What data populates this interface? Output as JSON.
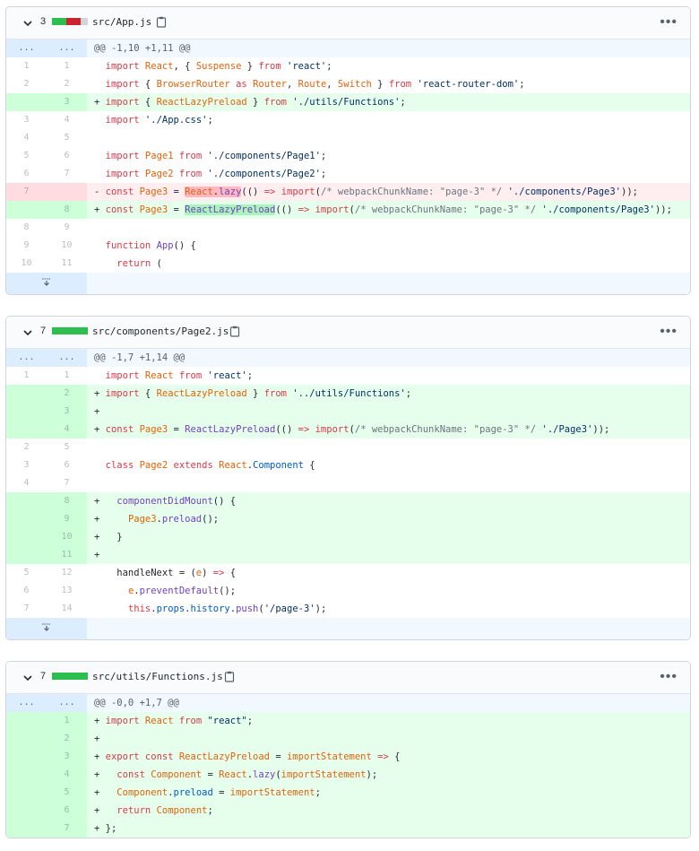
{
  "files": [
    {
      "count": "3",
      "name": "src/App.js",
      "stat": [
        "add",
        "add",
        "del",
        "del",
        "neutral"
      ],
      "menu": "•••",
      "expand_bottom": true,
      "lines": [
        {
          "type": "hunk",
          "n1": "...",
          "n2": "...",
          "text": "@@ -1,10 +1,11 @@"
        },
        {
          "type": "ctx",
          "n1": "1",
          "n2": "1",
          "text": "  import React, { Suspense } from 'react';"
        },
        {
          "type": "ctx",
          "n1": "2",
          "n2": "2",
          "text": "  import { BrowserRouter as Router, Route, Switch } from 'react-router-dom';"
        },
        {
          "type": "add",
          "n1": "",
          "n2": "3",
          "text": "+ import { ReactLazyPreload } from './utils/Functions';"
        },
        {
          "type": "ctx",
          "n1": "3",
          "n2": "4",
          "text": "  import './App.css';"
        },
        {
          "type": "ctx",
          "n1": "4",
          "n2": "5",
          "text": ""
        },
        {
          "type": "ctx",
          "n1": "5",
          "n2": "6",
          "text": "  import Page1 from './components/Page1';"
        },
        {
          "type": "ctx",
          "n1": "6",
          "n2": "7",
          "text": "  import Page2 from './components/Page2';"
        },
        {
          "type": "del",
          "n1": "7",
          "n2": "",
          "text": "- const Page3 = React.lazy(() => import(/* webpackChunkName: \"page-3\" */ './components/Page3'));"
        },
        {
          "type": "add",
          "n1": "",
          "n2": "8",
          "text": "+ const Page3 = ReactLazyPreload(() => import(/* webpackChunkName: \"page-3\" */ './components/Page3'));"
        },
        {
          "type": "ctx",
          "n1": "8",
          "n2": "9",
          "text": ""
        },
        {
          "type": "ctx",
          "n1": "9",
          "n2": "10",
          "text": "  function App() {"
        },
        {
          "type": "ctx",
          "n1": "10",
          "n2": "11",
          "text": "    return ("
        }
      ]
    },
    {
      "count": "7",
      "name": "src/components/Page2.js",
      "stat": [
        "add",
        "add",
        "add",
        "add",
        "add"
      ],
      "menu": "•••",
      "expand_bottom": true,
      "lines": [
        {
          "type": "hunk",
          "n1": "...",
          "n2": "...",
          "text": "@@ -1,7 +1,14 @@"
        },
        {
          "type": "ctx",
          "n1": "1",
          "n2": "1",
          "text": "  import React from 'react';"
        },
        {
          "type": "add",
          "n1": "",
          "n2": "2",
          "text": "+ import { ReactLazyPreload } from '../utils/Functions';"
        },
        {
          "type": "add",
          "n1": "",
          "n2": "3",
          "text": "+"
        },
        {
          "type": "add",
          "n1": "",
          "n2": "4",
          "text": "+ const Page3 = ReactLazyPreload(() => import(/* webpackChunkName: \"page-3\" */ './Page3'));"
        },
        {
          "type": "ctx",
          "n1": "2",
          "n2": "5",
          "text": ""
        },
        {
          "type": "ctx",
          "n1": "3",
          "n2": "6",
          "text": "  class Page2 extends React.Component {"
        },
        {
          "type": "ctx",
          "n1": "4",
          "n2": "7",
          "text": ""
        },
        {
          "type": "add",
          "n1": "",
          "n2": "8",
          "text": "+   componentDidMount() {"
        },
        {
          "type": "add",
          "n1": "",
          "n2": "9",
          "text": "+     Page3.preload();"
        },
        {
          "type": "add",
          "n1": "",
          "n2": "10",
          "text": "+   }"
        },
        {
          "type": "add",
          "n1": "",
          "n2": "11",
          "text": "+"
        },
        {
          "type": "ctx",
          "n1": "5",
          "n2": "12",
          "text": "    handleNext = (e) => {"
        },
        {
          "type": "ctx",
          "n1": "6",
          "n2": "13",
          "text": "      e.preventDefault();"
        },
        {
          "type": "ctx",
          "n1": "7",
          "n2": "14",
          "text": "      this.props.history.push('/page-3');"
        }
      ]
    },
    {
      "count": "7",
      "name": "src/utils/Functions.js",
      "stat": [
        "add",
        "add",
        "add",
        "add",
        "add"
      ],
      "menu": "•••",
      "expand_bottom": false,
      "lines": [
        {
          "type": "hunk",
          "n1": "...",
          "n2": "...",
          "text": "@@ -0,0 +1,7 @@"
        },
        {
          "type": "add",
          "n1": "",
          "n2": "1",
          "text": "+ import React from \"react\";"
        },
        {
          "type": "add",
          "n1": "",
          "n2": "2",
          "text": "+"
        },
        {
          "type": "add",
          "n1": "",
          "n2": "3",
          "text": "+ export const ReactLazyPreload = importStatement => {"
        },
        {
          "type": "add",
          "n1": "",
          "n2": "4",
          "text": "+   const Component = React.lazy(importStatement);"
        },
        {
          "type": "add",
          "n1": "",
          "n2": "5",
          "text": "+   Component.preload = importStatement;"
        },
        {
          "type": "add",
          "n1": "",
          "n2": "6",
          "text": "+   return Component;"
        },
        {
          "type": "add",
          "n1": "",
          "n2": "7",
          "text": "+ };"
        }
      ]
    }
  ],
  "colors": {
    "stat_add": "#2cbe4e",
    "stat_del": "#cb2431",
    "stat_neutral": "#d1d5da"
  }
}
